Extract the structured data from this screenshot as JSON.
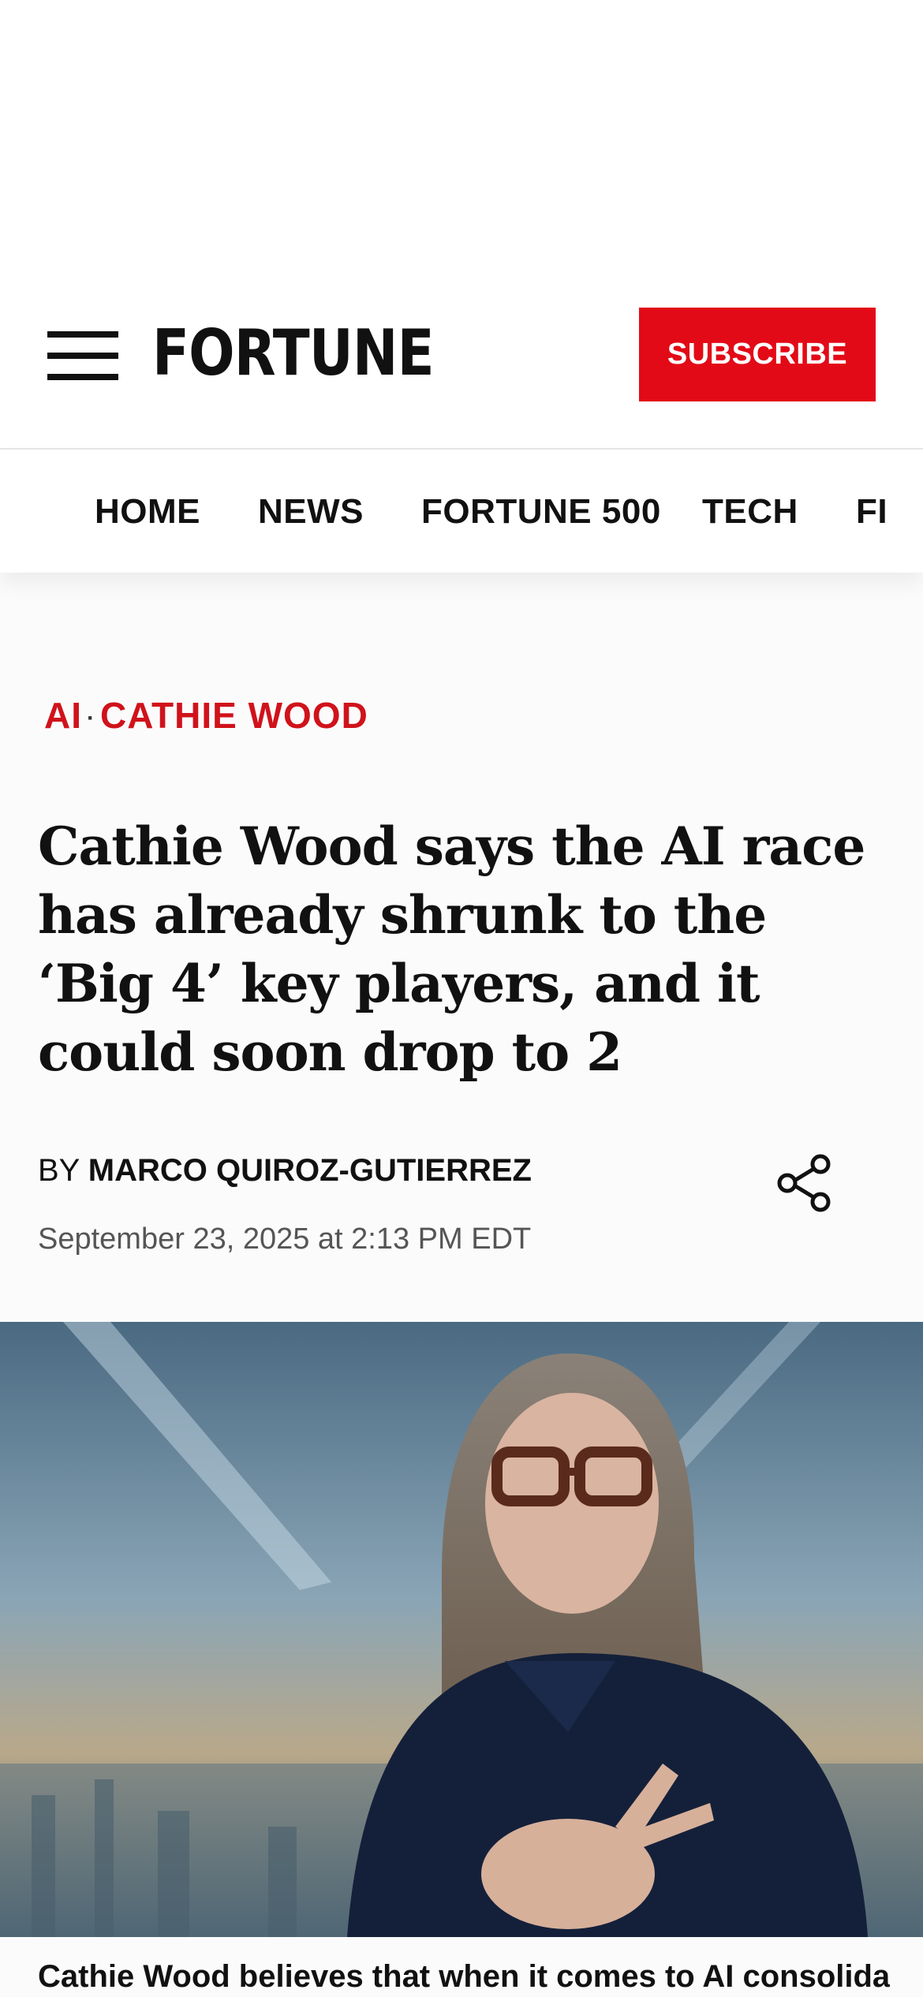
{
  "header": {
    "logo": "FORTUNE",
    "subscribe_label": "SUBSCRIBE"
  },
  "nav": {
    "items": [
      "HOME",
      "NEWS",
      "FORTUNE 500",
      "TECH",
      "FI"
    ]
  },
  "article": {
    "categories": [
      "AI",
      "CATHIE WOOD"
    ],
    "category_separator": "·",
    "headline": "Cathie Wood says the AI race has already shrunk to the ‘Big 4’ key players, and it could soon drop to 2",
    "byline_prefix": "BY",
    "author": "MARCO QUIROZ-GUTIERREZ",
    "timestamp": "September 23, 2025 at 2:13 PM EDT",
    "caption": "Cathie Wood believes that when it comes to AI consolidation,"
  },
  "colors": {
    "brand_red": "#e30a17",
    "category_red": "#d0121b"
  },
  "icons": {
    "menu": "hamburger-menu-icon",
    "share": "share-icon"
  }
}
